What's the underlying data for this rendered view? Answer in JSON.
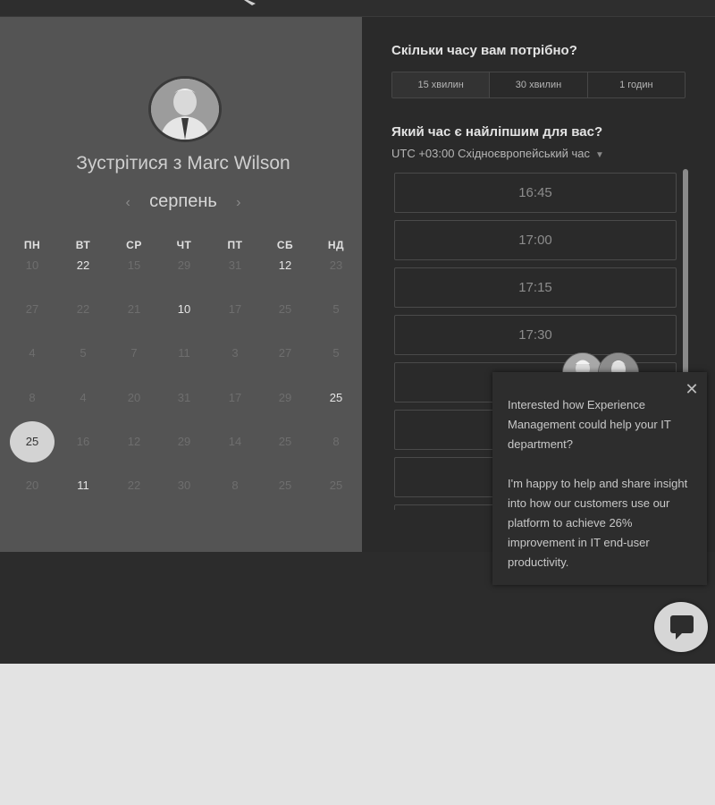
{
  "header": {
    "logo_icon": "brand-logo-icon"
  },
  "calendar": {
    "title": "Зустрітися з Marc Wilson",
    "month": "серпень",
    "prev_icon": "chevron-left-icon",
    "next_icon": "chevron-right-icon",
    "weekdays": [
      "ПН",
      "ВТ",
      "СР",
      "ЧТ",
      "ПТ",
      "СБ",
      "НД"
    ],
    "rows": [
      [
        "10",
        "22",
        "15",
        "29",
        "31",
        "12",
        "23"
      ],
      [
        "27",
        "22",
        "21",
        "10",
        "17",
        "25",
        "5"
      ],
      [
        "4",
        "5",
        "7",
        "11",
        "3",
        "27",
        "5"
      ],
      [
        "8",
        "4",
        "20",
        "31",
        "17",
        "29",
        "25"
      ],
      [
        "25",
        "16",
        "12",
        "29",
        "14",
        "25",
        "8"
      ],
      [
        "20",
        "11",
        "22",
        "30",
        "8",
        "25",
        "25"
      ]
    ],
    "available": [
      [
        0,
        1
      ],
      [
        0,
        5
      ],
      [
        1,
        3
      ],
      [
        3,
        6
      ],
      [
        5,
        1
      ]
    ],
    "selected": [
      4,
      0
    ]
  },
  "scheduler": {
    "duration_question": "Скільки часу вам потрібно?",
    "durations": [
      "15 хвилин",
      "30 хвилин",
      "1 годин"
    ],
    "active_duration": 0,
    "time_question": "Який час є найліпшим для вас?",
    "timezone": "UTC +03:00 Східноєвропейський час",
    "timezone_icon": "caret-down-icon",
    "slots": [
      "16:45",
      "17:00",
      "17:15",
      "17:30",
      "",
      "",
      "",
      ""
    ]
  },
  "chat": {
    "close_icon": "close-icon",
    "message_1": "Interested how Experience Management could help your IT department?",
    "message_2": "I'm happy to help and share insight into how our customers use our platform to achieve 26% improvement in IT end-user productivity.",
    "launcher_icon": "chat-bubble-icon"
  }
}
